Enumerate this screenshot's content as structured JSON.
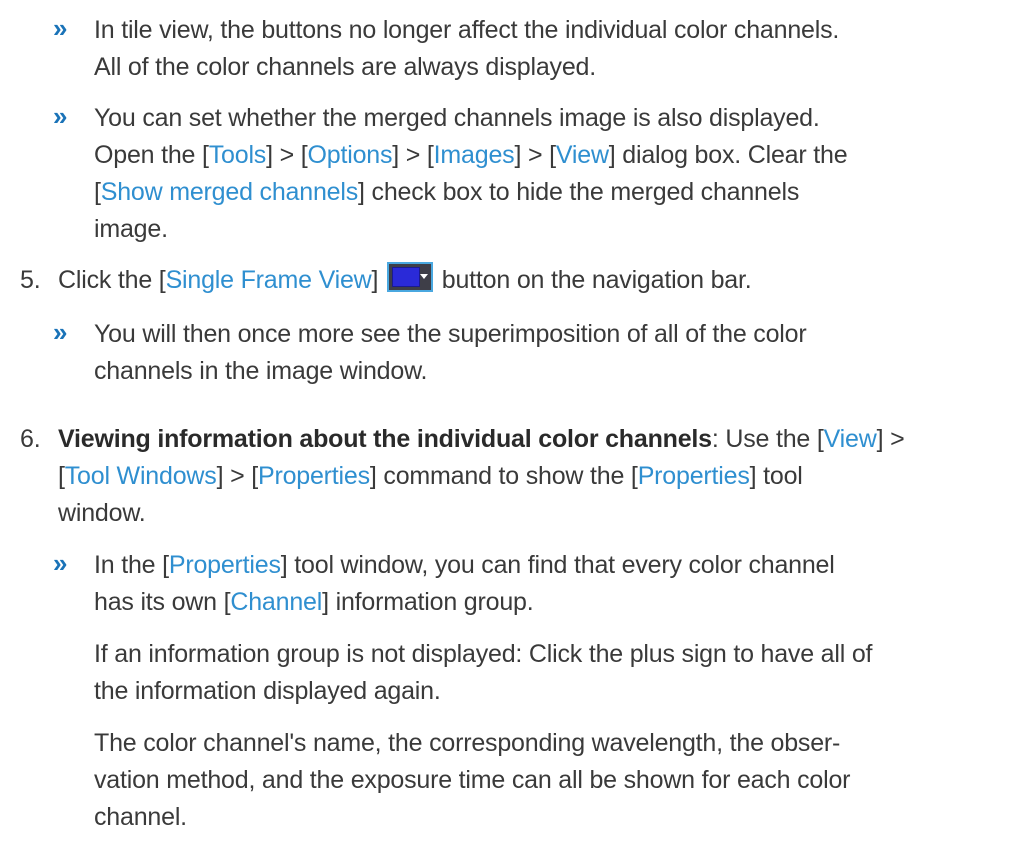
{
  "bullet_glyph": "»",
  "block1": {
    "line1": "In tile view, the buttons no longer affect the individual color channels.",
    "line2": "All of the color channels are always displayed."
  },
  "block2": {
    "line1": "You can set whether the merged channels image is also displayed.",
    "line2_text1": "Open the [",
    "line2_link1": "Tools",
    "line2_text2": "] > [",
    "line2_link2": "Options",
    "line2_text3": "] > [",
    "line2_link3": "Images",
    "line2_text4": "] > [",
    "line2_link4": "View",
    "line2_text5": "] dialog box. Clear the",
    "line3_text1": "[",
    "line3_link1": "Show merged channels",
    "line3_text2": "] check box to hide the merged channels",
    "line4": "image."
  },
  "step5": {
    "number": "5.",
    "text1": "Click the [",
    "link1": "Single Frame View",
    "text2": "]",
    "icon_name": "single-frame-view-icon",
    "text3": " button on the navigation bar.",
    "result_line1": "You will then once more see the superimposition of all of the color",
    "result_line2": "channels in the image window."
  },
  "step6": {
    "number": "6.",
    "heading": "Viewing information about the individual color channels",
    "line1_text1": ": Use the [",
    "line1_link1": "View",
    "line1_text2": "] >",
    "line2_text1": "[",
    "line2_link1": "Tool Windows",
    "line2_text2": "] > [",
    "line2_link2": "Properties",
    "line2_text3": "] command to show the [",
    "line2_link3": "Properties",
    "line2_text4": "] tool",
    "line3": "window.",
    "result1_text1": "In the [",
    "result1_link1": "Properties",
    "result1_text2": "] tool window, you can find that every color channel",
    "result2_text1": "has its own [",
    "result2_link1": "Channel",
    "result2_text2": "] information group.",
    "para1_line1": "If an information group is not displayed: Click the plus sign to have all of",
    "para1_line2": "the information displayed again.",
    "para2_line1": "The color channel's name, the corresponding wavelength, the obser-",
    "para2_line2": "vation method, and the exposure time can all be shown for each color",
    "para2_line3": "channel."
  },
  "colors": {
    "link": "#2f8fd0",
    "bullet": "#1a73b8",
    "text": "#3a3a3a",
    "icon_border": "#4aa8e0",
    "icon_fill": "#2a2ad8"
  }
}
